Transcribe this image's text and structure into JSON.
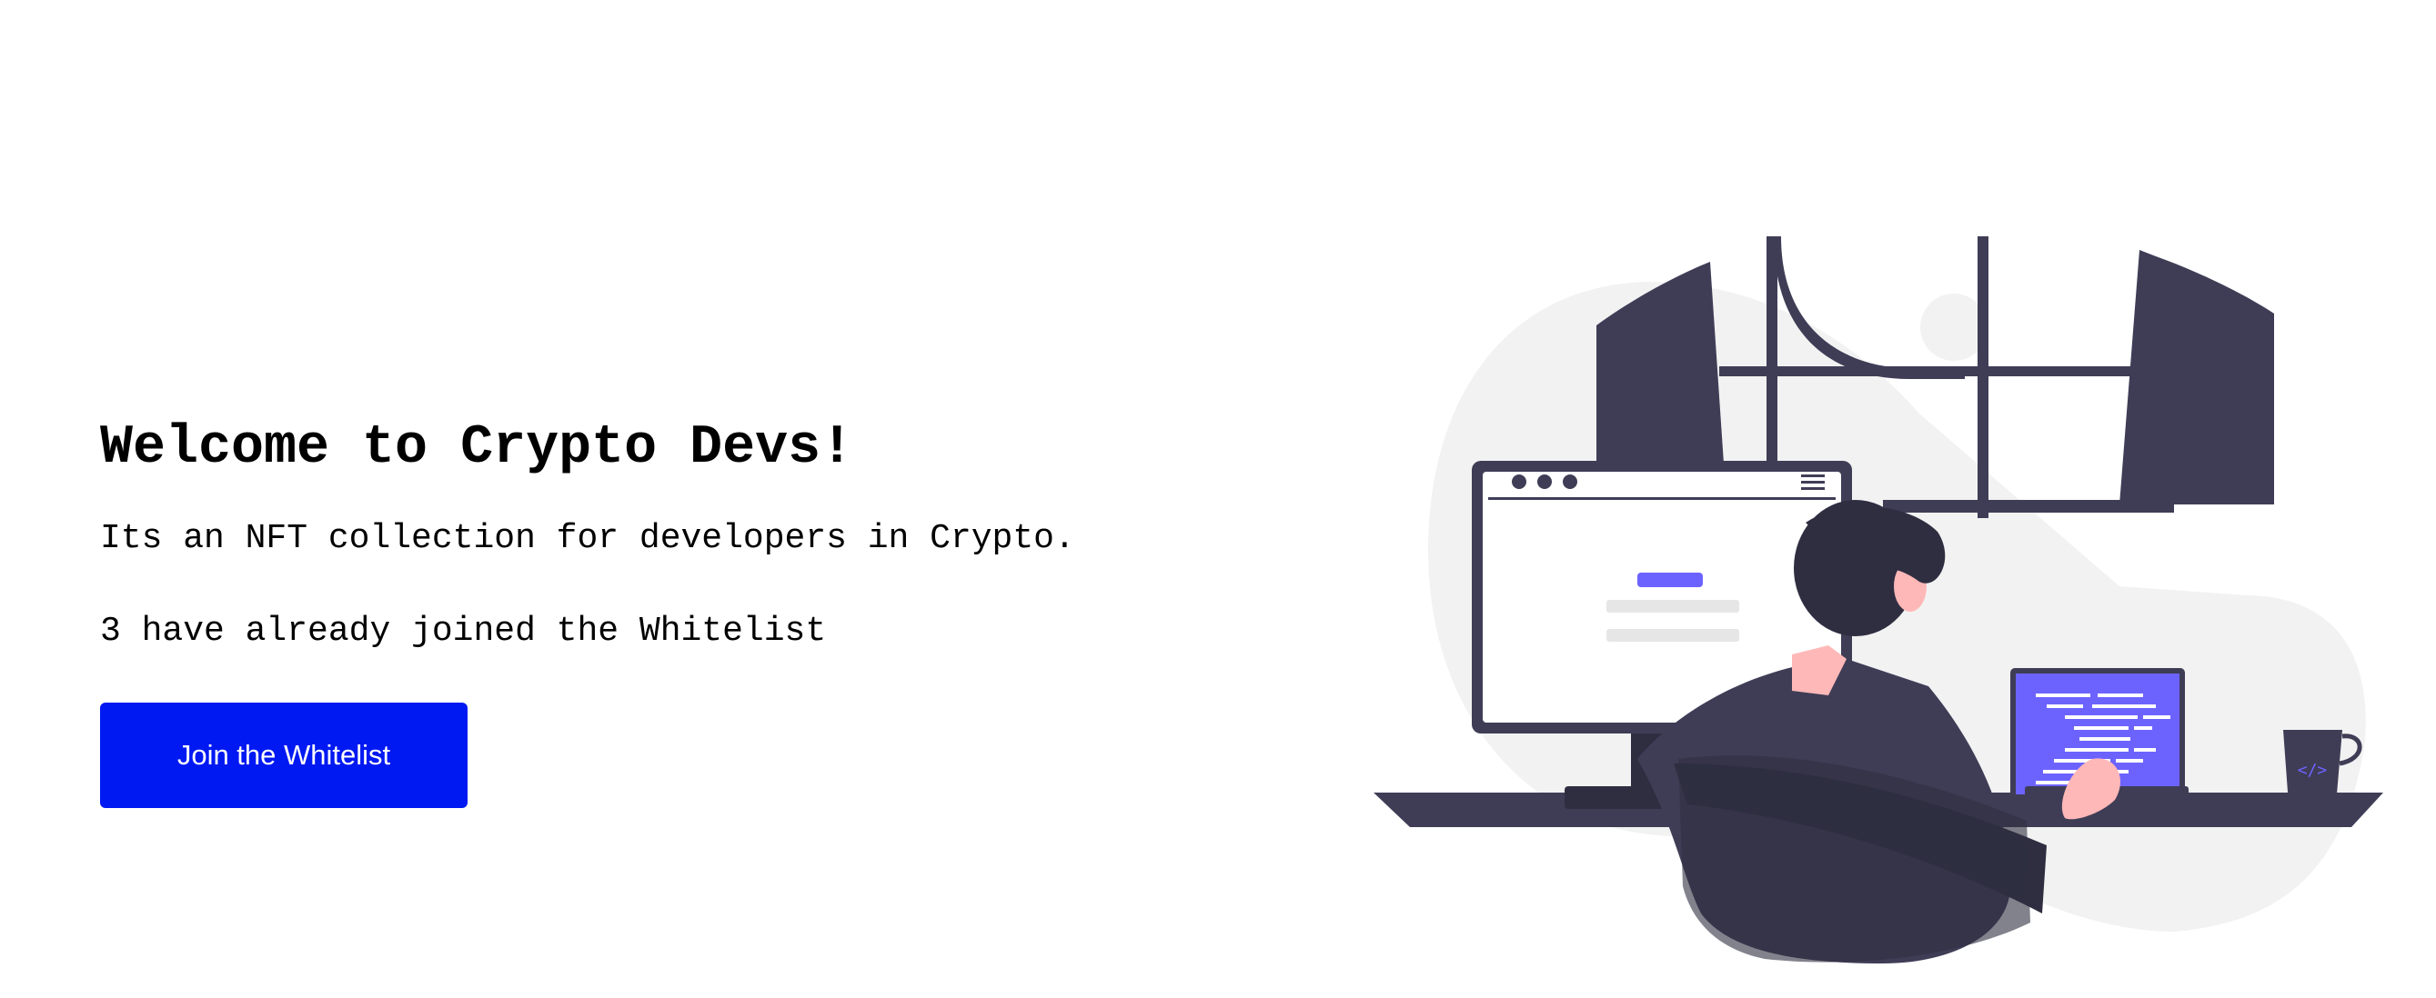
{
  "hero": {
    "title": "Welcome to Crypto Devs!",
    "description": "Its an NFT collection for developers in Crypto.",
    "whitelist_status": "3 have already joined the Whitelist",
    "join_button_label": "Join the Whitelist"
  },
  "illustration": {
    "icon": "developer-at-desk-illustration",
    "colors": {
      "dark": "#3f3d56",
      "darker": "#2f2e41",
      "accent": "#6c63ff",
      "background_blob": "#f2f2f2",
      "skin": "#ffb8b8"
    }
  },
  "colors": {
    "button": "#0019f2",
    "button_text": "#ffffff",
    "text": "#000000",
    "background": "#ffffff"
  }
}
